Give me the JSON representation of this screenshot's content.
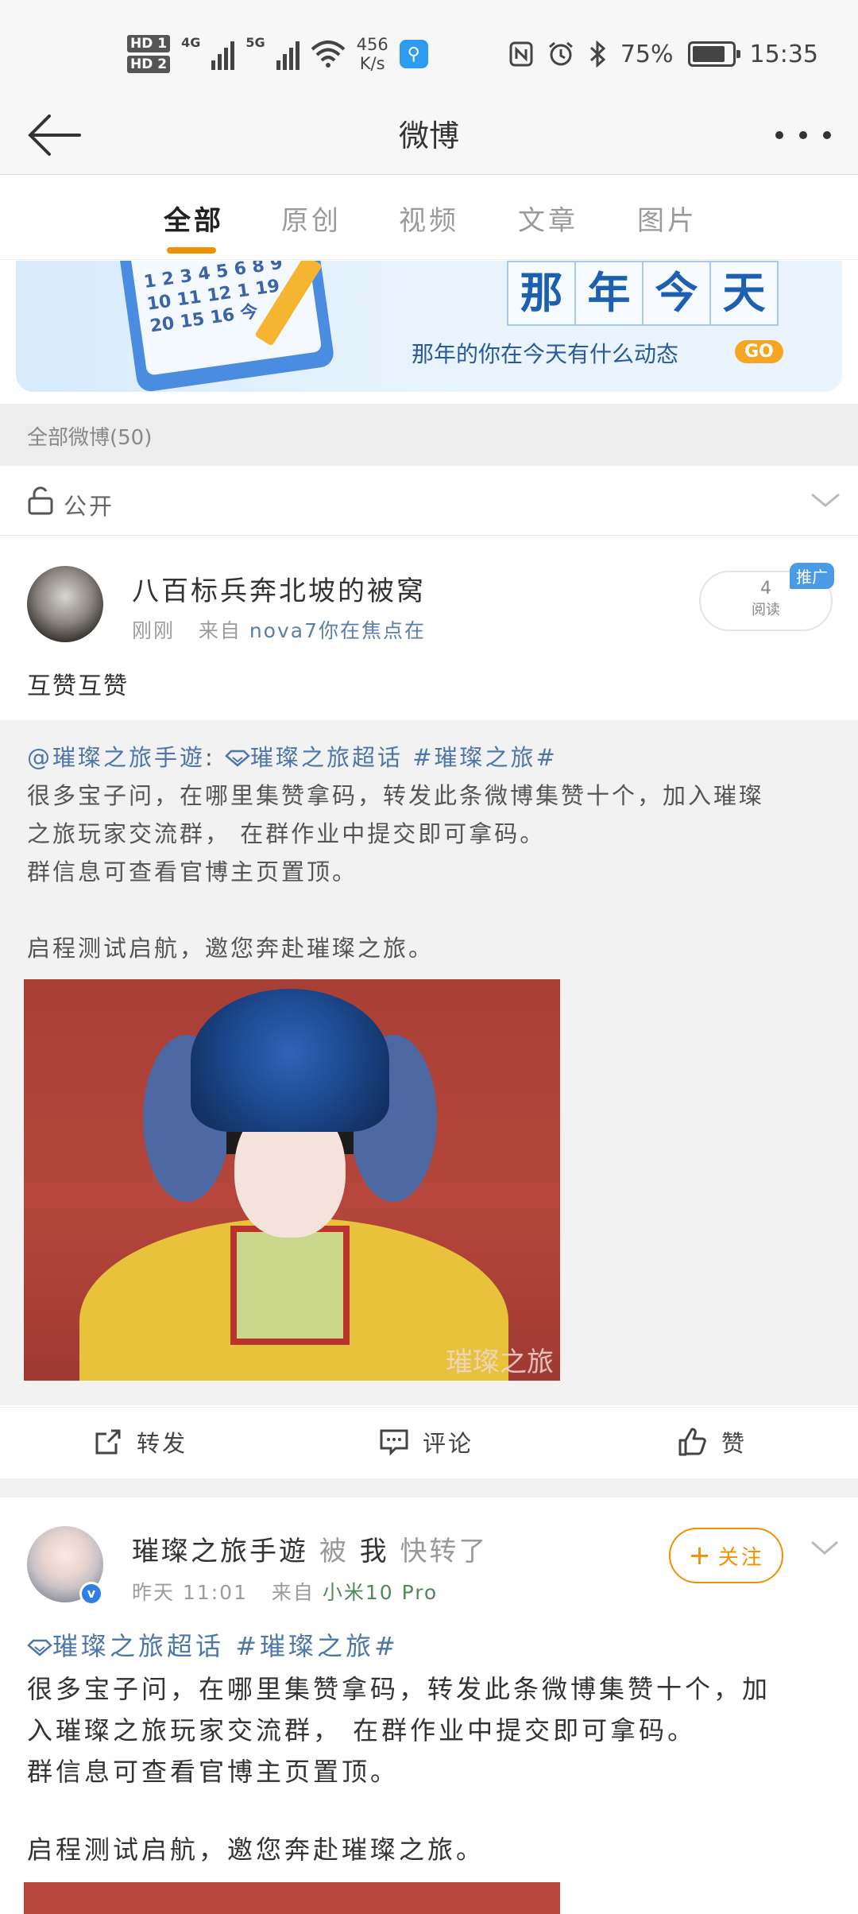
{
  "status_bar": {
    "hd1": "HD 1",
    "hd2": "HD 2",
    "net1": "4G",
    "net2": "5G",
    "speed_value": "456",
    "speed_unit": "K/s",
    "battery": "75%",
    "time": "15:35",
    "icons": [
      "nfc-icon",
      "alarm-icon",
      "bluetooth-icon"
    ]
  },
  "nav": {
    "title": "微博"
  },
  "tabs": [
    {
      "label": "全部",
      "active": true
    },
    {
      "label": "原创"
    },
    {
      "label": "视频"
    },
    {
      "label": "文章"
    },
    {
      "label": "图片"
    }
  ],
  "banner": {
    "chars": [
      "那",
      "年",
      "今",
      "天"
    ],
    "subtitle": "那年的你在今天有什么动态",
    "go": "GO",
    "calendar_text": "1 2 3 4 5 6 8 9 10 11 12 1 19 20 15 16 今"
  },
  "section": {
    "count_label": "全部微博(50)"
  },
  "filter": {
    "label": "公开"
  },
  "post1": {
    "username": "八百标兵奔北坡的被窝",
    "time": "刚刚",
    "from_label": "来自",
    "source": "nova7你在焦点在",
    "views_count": "4",
    "views_label": "阅读",
    "promo": "推广",
    "text": "互赞互赞",
    "fwd_mention": "@璀璨之旅手遊",
    "fwd_colon": ":",
    "fwd_topic1": "璀璨之旅超话",
    "fwd_topic2": "#璀璨之旅#",
    "fwd_line1": "很多宝子问，在哪里集赞拿码，转发此条微博集赞十个，加入璀璨",
    "fwd_line2": "之旅玩家交流群， 在群作业中提交即可拿码。",
    "fwd_line3": "群信息可查看官博主页置顶。",
    "fwd_line4": "启程测试启航，邀您奔赴璀璨之旅。",
    "image_watermark": "璀璨之旅"
  },
  "actions": {
    "repost": "转发",
    "comment": "评论",
    "like": "赞"
  },
  "post2": {
    "username": "璀璨之旅手遊",
    "by": "被",
    "me": "我",
    "action": "快转了",
    "time": "昨天 11:01",
    "from_label": "来自",
    "source": "小米10 Pro",
    "follow": "关注",
    "topic1": "璀璨之旅超话",
    "topic2": "#璀璨之旅#",
    "line1": "很多宝子问，在哪里集赞拿码，转发此条微博集赞十个，加",
    "line2": "入璀璨之旅玩家交流群， 在群作业中提交即可拿码。",
    "line3": "群信息可查看官博主页置顶。",
    "line4": "启程测试启航，邀您奔赴璀璨之旅。"
  },
  "colors": {
    "accent": "#f29100",
    "link": "#4e77a8",
    "banner_blue": "#1d5fb1"
  }
}
